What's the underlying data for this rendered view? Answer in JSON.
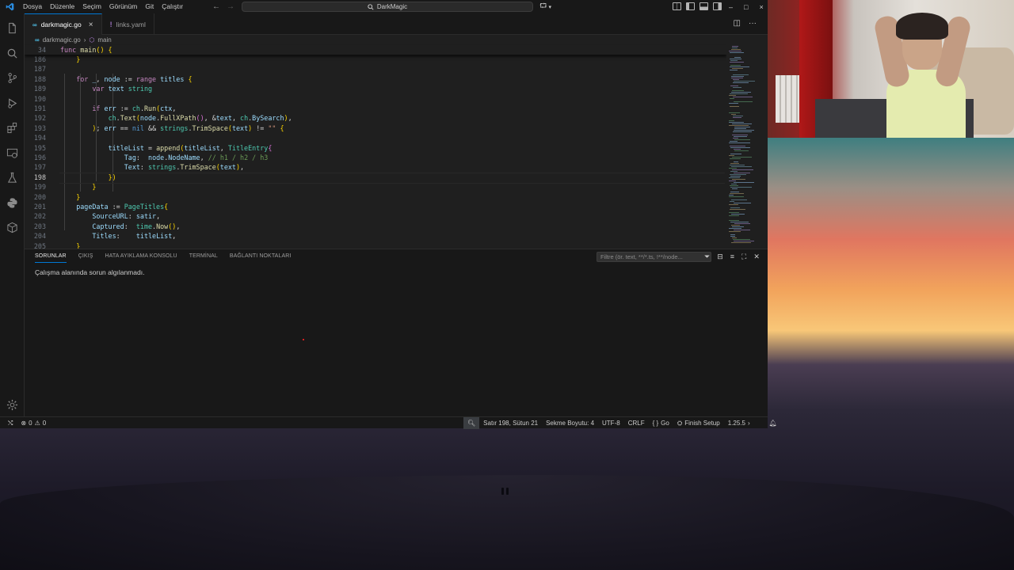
{
  "window": {
    "title": "DarkMagic",
    "menu": [
      "Dosya",
      "Düzenle",
      "Seçim",
      "Görünüm",
      "Git",
      "Çalıştır"
    ],
    "controls": [
      "–",
      "□",
      "×"
    ]
  },
  "tabs": [
    {
      "label": "darkmagic.go",
      "icon": "go-file-icon",
      "active": true
    },
    {
      "label": "links.yaml",
      "icon": "yaml-file-icon",
      "active": false
    }
  ],
  "breadcrumb": {
    "file": "darkmagic.go",
    "symbol": "main"
  },
  "editor": {
    "sticky_line": {
      "number": "34",
      "text": "func main() {"
    },
    "lines": [
      {
        "number": "186",
        "text": "    }"
      },
      {
        "number": "187",
        "text": ""
      },
      {
        "number": "188",
        "text": "    for _, node := range titles {"
      },
      {
        "number": "189",
        "text": "        var text string"
      },
      {
        "number": "190",
        "text": ""
      },
      {
        "number": "191",
        "text": "        if err := ch.Run(ctx,"
      },
      {
        "number": "192",
        "text": "            ch.Text(node.FullXPath(), &text, ch.BySearch),"
      },
      {
        "number": "193",
        "text": "        ); err == nil && strings.TrimSpace(text) != \"\" {"
      },
      {
        "number": "194",
        "text": ""
      },
      {
        "number": "195",
        "text": "            titleList = append(titleList, TitleEntry{"
      },
      {
        "number": "196",
        "text": "                Tag:  node.NodeName, // h1 / h2 / h3"
      },
      {
        "number": "197",
        "text": "                Text: strings.TrimSpace(text),"
      },
      {
        "number": "198",
        "text": "            })"
      },
      {
        "number": "199",
        "text": "        }"
      },
      {
        "number": "200",
        "text": "    }"
      },
      {
        "number": "201",
        "text": "    pageData := PageTitles{"
      },
      {
        "number": "202",
        "text": "        SourceURL: satir,"
      },
      {
        "number": "203",
        "text": "        Captured:  time.Now(),"
      },
      {
        "number": "204",
        "text": "        Titles:    titleList,"
      },
      {
        "number": "205",
        "text": "    }"
      }
    ]
  },
  "panel": {
    "tabs": [
      "SORUNLAR",
      "ÇIKIŞ",
      "HATA AYIKLAMA KONSOLU",
      "TERMİNAL",
      "BAĞLANTI NOKTALARI"
    ],
    "filter_placeholder": "Filtre (ör. text, **/*.ts, !**/node...",
    "message": "Çalışma alanında sorun algılanmadı."
  },
  "statusbar": {
    "errors": "0",
    "warnings": "0",
    "position": "Satır 198, Sütun 21",
    "indent": "Sekme Boyutu: 4",
    "encoding": "UTF-8",
    "eol": "CRLF",
    "language": "Go",
    "setup": "Finish Setup",
    "version": "1.25.5"
  }
}
